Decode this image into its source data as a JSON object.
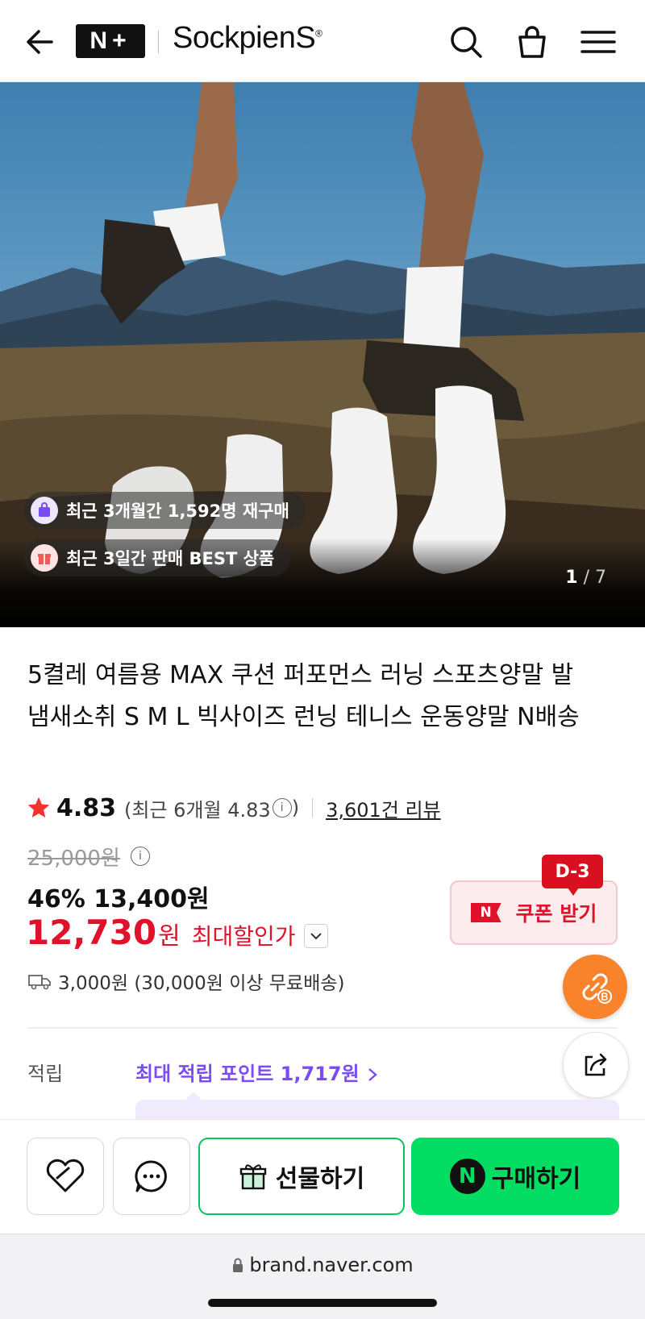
{
  "header": {
    "nplus_logo": "N+",
    "brand_name": "SockpienS",
    "brand_mark": "®",
    "icons": [
      "back-arrow-icon",
      "search-icon",
      "shopping-bag-icon",
      "menu-icon"
    ]
  },
  "hero": {
    "badges": [
      {
        "icon": "shopping-bag-icon",
        "text": "최근 3개월간 1,592명 재구매",
        "color": "#7a4cf4"
      },
      {
        "icon": "gift-icon",
        "text": "최근 3일간 판매 BEST 상품",
        "color": "#f25a5a"
      }
    ],
    "pager_current": "1",
    "pager_total": "/ 7"
  },
  "product": {
    "title": "5켤레 여름용 MAX 쿠션 퍼포먼스 러닝 스포츠양말 발냄새소취 S M L 빅사이즈 런닝 테니스 운동양말 N배송",
    "rating": "4.83",
    "rating_sub_open": "(최근 6개월 4.83",
    "rating_sub_close": ")",
    "review_count": "3,601건 리뷰",
    "original_price": "25,000원",
    "discount_rate": "46%",
    "discount_price": "13,400원",
    "final_price": "12,730",
    "final_unit": "원",
    "max_discount_label": "최대할인가",
    "shipping": "3,000원 (30,000원 이상 무료배송)"
  },
  "coupon": {
    "badge": "D-3",
    "label": "쿠폰 받기",
    "flag": "N"
  },
  "points": {
    "label": "적립",
    "value": "최대 적립 포인트 1,717원"
  },
  "bottom_bar": {
    "gift_label": "선물하기",
    "buy_label": "구매하기",
    "buy_logo": "N"
  },
  "browser": {
    "url": "brand.naver.com"
  },
  "colors": {
    "accent_red": "#e0112b",
    "naver_green": "#03dd63",
    "points_purple": "#7a4cf4",
    "orange": "#f8832a"
  }
}
